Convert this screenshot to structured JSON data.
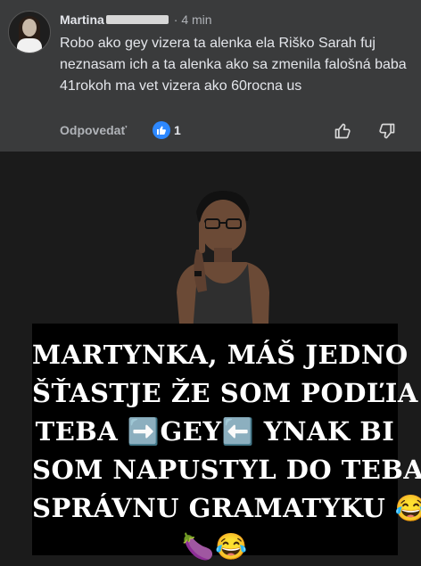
{
  "comment": {
    "author": "Martina",
    "time": "· 4 min",
    "text": "Robo ako gey vizera ta alenka ela Riško Sarah fuj neznasam ich a ta alenka ako sa zmenila falošná baba 41rokoh ma vet vizera ako 60rocna us",
    "reply_label": "Odpovedať",
    "like_count": "1",
    "icons": {
      "avatar": "profile-avatar",
      "like_badge": "thumbs-up-icon",
      "like_button": "thumbs-up-outline-icon",
      "dislike_button": "thumbs-down-outline-icon"
    }
  },
  "meme": {
    "caption_lines": [
      "MARTYNKA, MÁŠ JEDNO",
      "ŠŤASTJE ŽE SOM PODĽIA",
      "TEBA ➡️GEY⬅️ YNAK BI",
      "SOM NAPUSTYL DO TEBA",
      "SPRÁVNU GRAMATYKU 😂",
      "🍆😂"
    ]
  },
  "colors": {
    "card_bg": "#3a3b3c",
    "page_bg": "#1b1b1b",
    "text_primary": "#e4e6eb",
    "text_secondary": "#b0b3b8",
    "like_blue": "#2d88ff"
  }
}
